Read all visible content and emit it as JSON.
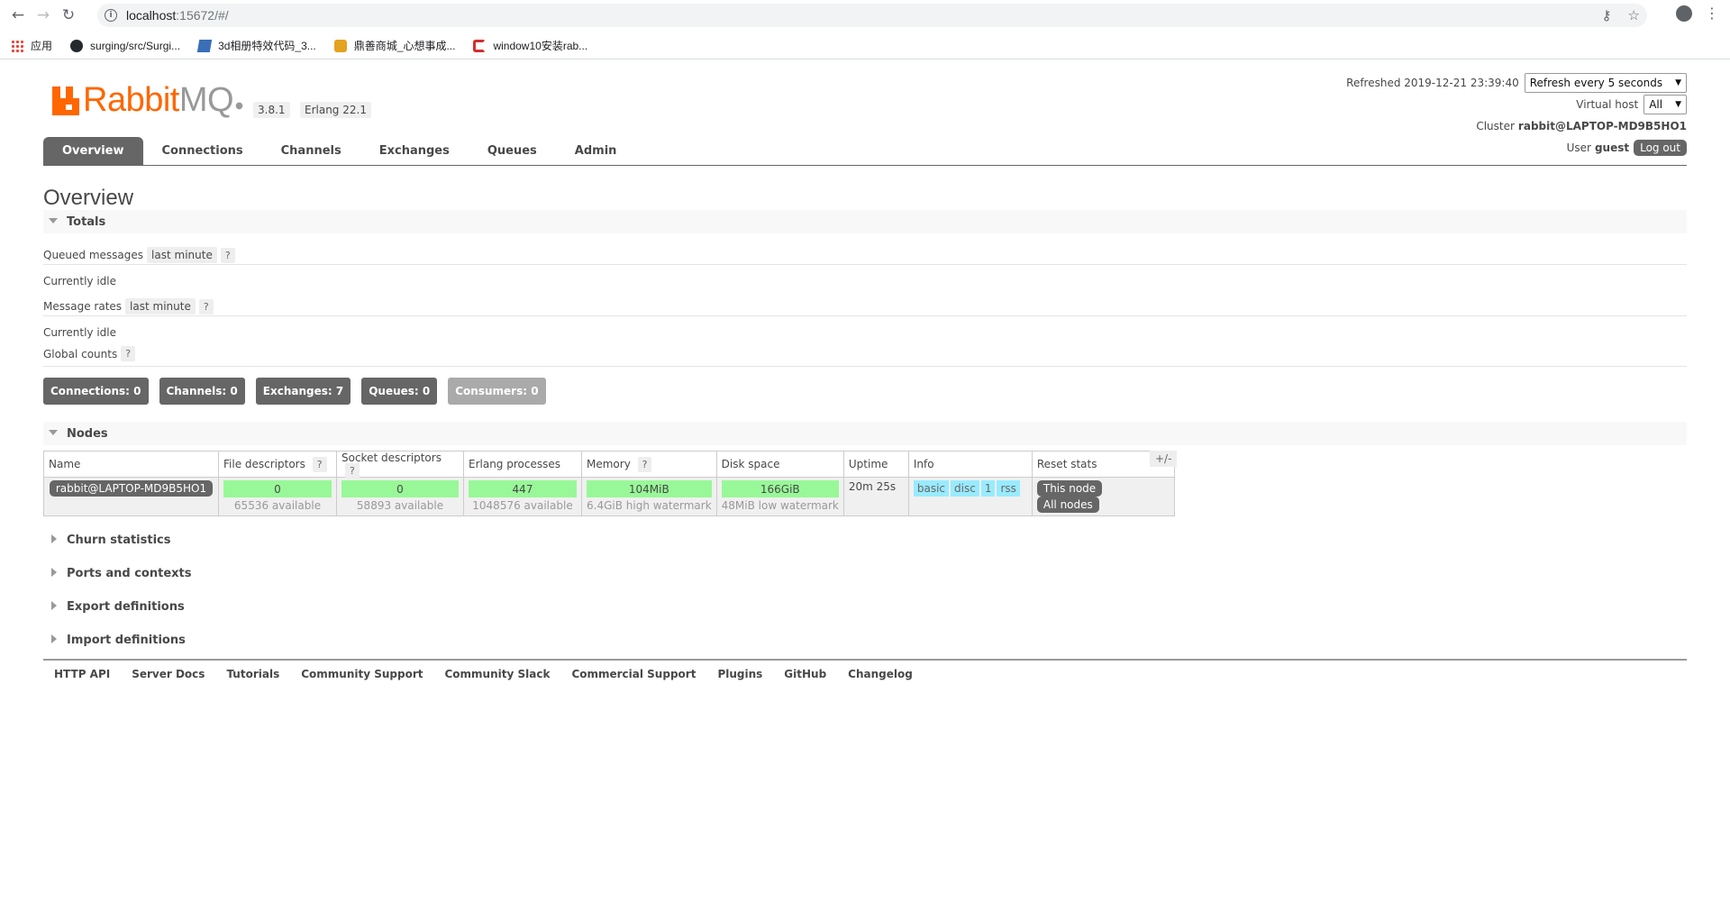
{
  "browser": {
    "url_host": "localhost",
    "url_rest": ":15672/#/",
    "bookmarks": [
      {
        "label": "应用",
        "icon": "apps-icon"
      },
      {
        "label": "surging/src/Surgi...",
        "icon": "github-icon"
      },
      {
        "label": "3d相册特效代码_3...",
        "icon": "bookmark-3d-icon"
      },
      {
        "label": "鼎善商城_心想事成...",
        "icon": "shop-icon"
      },
      {
        "label": "window10安装rab...",
        "icon": "c-site-icon"
      }
    ]
  },
  "header": {
    "logo_rabbit": "Rabbit",
    "logo_mq": "MQ",
    "version": "3.8.1",
    "erlang": "Erlang 22.1",
    "refreshed": "Refreshed 2019-12-21 23:39:40",
    "refresh_select": "Refresh every 5 seconds",
    "vhost_label": "Virtual host",
    "vhost_value": "All",
    "cluster_label": "Cluster",
    "cluster_value": "rabbit@LAPTOP-MD9B5HO1",
    "user_label": "User",
    "user_value": "guest",
    "logout": "Log out"
  },
  "tabs": [
    "Overview",
    "Connections",
    "Channels",
    "Exchanges",
    "Queues",
    "Admin"
  ],
  "page_title": "Overview",
  "totals": {
    "heading": "Totals",
    "queued_label": "Queued messages",
    "queued_period": "last minute",
    "queued_status": "Currently idle",
    "rates_label": "Message rates",
    "rates_period": "last minute",
    "rates_status": "Currently idle",
    "global_label": "Global counts",
    "help": "?"
  },
  "counts": [
    {
      "label": "Connections: 0",
      "disabled": false
    },
    {
      "label": "Channels: 0",
      "disabled": false
    },
    {
      "label": "Exchanges: 7",
      "disabled": false
    },
    {
      "label": "Queues: 0",
      "disabled": false
    },
    {
      "label": "Consumers: 0",
      "disabled": true
    }
  ],
  "nodes": {
    "heading": "Nodes",
    "columns": [
      "Name",
      "File descriptors",
      "Socket descriptors",
      "Erlang processes",
      "Memory",
      "Disk space",
      "Uptime",
      "Info",
      "Reset stats"
    ],
    "row": {
      "name": "rabbit@LAPTOP-MD9B5HO1",
      "fd": "0",
      "fd_sub": "65536 available",
      "sd": "0",
      "sd_sub": "58893 available",
      "ep": "447",
      "ep_sub": "1048576 available",
      "mem": "104MiB",
      "mem_sub": "6.4GiB high watermark",
      "disk": "166GiB",
      "disk_sub": "48MiB low watermark",
      "uptime": "20m 25s",
      "info_tags": [
        "basic",
        "disc",
        "1",
        "rss"
      ],
      "reset_this": "This node",
      "reset_all": "All nodes"
    },
    "plusminus": "+/-"
  },
  "collapsed_sections": [
    "Churn statistics",
    "Ports and contexts",
    "Export definitions",
    "Import definitions"
  ],
  "footer": [
    "HTTP API",
    "Server Docs",
    "Tutorials",
    "Community Support",
    "Community Slack",
    "Commercial Support",
    "Plugins",
    "GitHub",
    "Changelog"
  ]
}
